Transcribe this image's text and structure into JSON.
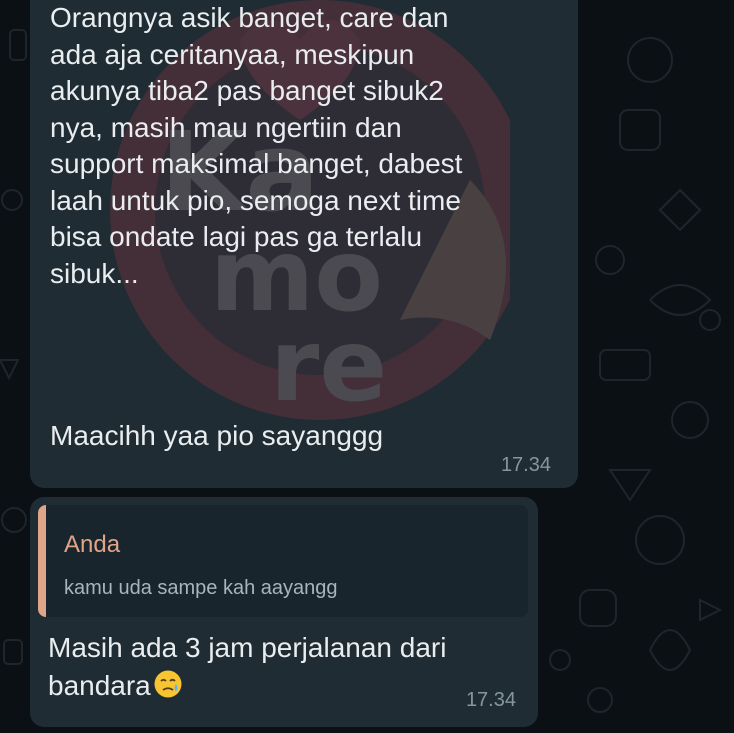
{
  "colors": {
    "background": "#0b1014",
    "bubble": "#1f2c33",
    "quote_background": "#18252c",
    "quote_accent": "#e0a489",
    "text": "#e9edef",
    "timestamp": "#8696a0",
    "watermark": "#c9374a"
  },
  "messages": [
    {
      "text": "Orangnya asik banget, care dan\nada aja ceritanyaa, meskipun\nakunya tiba2 pas banget sibuk2\nnya, masih mau ngertiin dan\nsupport maksimal banget, dabest\nlaah untuk pio, semoga next time\nbisa ondate lagi pas ga terlalu\nsibuk...",
      "closing": "Maacihh yaa pio sayanggg",
      "time": "17.34"
    },
    {
      "quote": {
        "author": "Anda",
        "text": "kamu uda sampe kah aayangg"
      },
      "text": "Masih ada 3 jam perjalanan dari\nbandara",
      "emoji": "crying-face-icon",
      "time": "17.34"
    }
  ]
}
